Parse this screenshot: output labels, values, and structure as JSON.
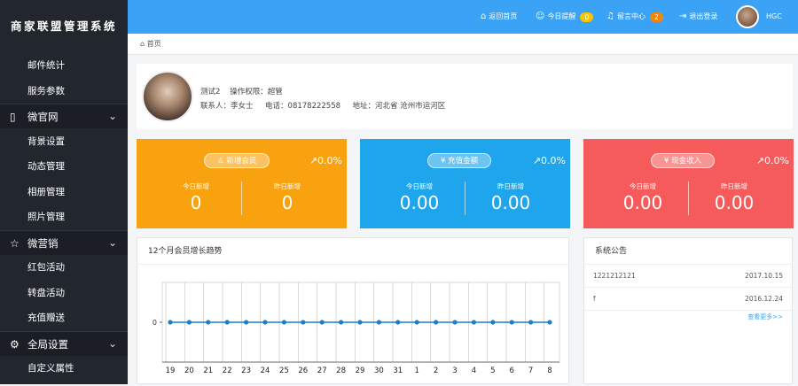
{
  "app": {
    "title": "商家联盟管理系统"
  },
  "sidebar": {
    "items": [
      {
        "label": "邮件统计",
        "type": "sub",
        "icon": ""
      },
      {
        "label": "服务参数",
        "type": "sub",
        "icon": ""
      },
      {
        "label": "微官网",
        "type": "group",
        "icon": "phone-icon"
      },
      {
        "label": "背景设置",
        "type": "sub",
        "icon": ""
      },
      {
        "label": "动态管理",
        "type": "sub",
        "icon": ""
      },
      {
        "label": "相册管理",
        "type": "sub",
        "icon": ""
      },
      {
        "label": "照片管理",
        "type": "sub",
        "icon": ""
      },
      {
        "label": "微营销",
        "type": "group",
        "icon": "star-icon"
      },
      {
        "label": "红包活动",
        "type": "sub",
        "icon": ""
      },
      {
        "label": "转盘活动",
        "type": "sub",
        "icon": ""
      },
      {
        "label": "充值赠送",
        "type": "sub",
        "icon": ""
      },
      {
        "label": "全局设置",
        "type": "group",
        "icon": "gear-icon"
      },
      {
        "label": "自定义属性",
        "type": "sub",
        "icon": ""
      }
    ]
  },
  "header": {
    "home": "返回首页",
    "reminders": "今日提醒",
    "reminders_count": "0",
    "messages": "留言中心",
    "messages_count": "2",
    "logout": "退出登录",
    "user": "HGC"
  },
  "breadcrumb": {
    "home": "首页"
  },
  "profile": {
    "name": "测试2",
    "permission": "操作权限：超管",
    "contact": "联系人：李女士",
    "phone": "电话：08178222558",
    "address": "地址：河北省 沧州市运河区"
  },
  "cards": [
    {
      "title": "新增会员",
      "pct": "↗0.0%",
      "today_label": "今日新增",
      "today": "0",
      "yesterday_label": "昨日新增",
      "yesterday": "0",
      "color": "#f9a20f"
    },
    {
      "title": "充值金额",
      "pct": "↗0.0%",
      "today_label": "今日新增",
      "today": "0.00",
      "yesterday_label": "昨日新增",
      "yesterday": "0.00",
      "color": "#1ea5ec"
    },
    {
      "title": "现金收入",
      "pct": "↗0.0%",
      "today_label": "今日新增",
      "today": "0.00",
      "yesterday_label": "昨日新增",
      "yesterday": "0.00",
      "color": "#f55b5b"
    }
  ],
  "chart": {
    "title": "12个月会员增长趋势"
  },
  "chart_data": {
    "type": "line",
    "x": [
      "19",
      "20",
      "21",
      "22",
      "23",
      "24",
      "25",
      "26",
      "27",
      "28",
      "29",
      "30",
      "31",
      "1",
      "2",
      "3",
      "4",
      "5",
      "6",
      "7",
      "8"
    ],
    "series": [
      {
        "values": [
          0,
          0,
          0,
          0,
          0,
          0,
          0,
          0,
          0,
          0,
          0,
          0,
          0,
          0,
          0,
          0,
          0,
          0,
          0,
          0,
          0
        ]
      }
    ],
    "yticks": [
      "0"
    ],
    "grid": true,
    "color": "#1e7fc6"
  },
  "notice": {
    "title": "系统公告",
    "rows": [
      {
        "text": "1221212121",
        "date": "2017.10.15"
      },
      {
        "text": "f",
        "date": "2016.12.24"
      }
    ],
    "more": "查看更多>>"
  }
}
